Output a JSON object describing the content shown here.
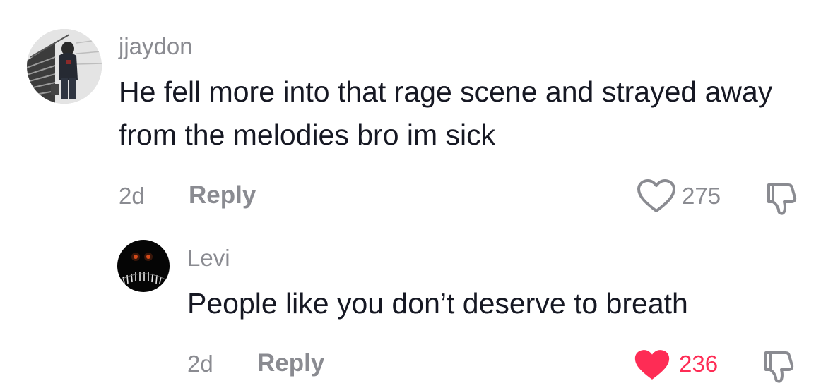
{
  "comments": [
    {
      "username": "jjaydon",
      "text": "He fell more into that rage scene and strayed away from the melodies bro im sick",
      "age": "2d",
      "reply_label": "Reply",
      "likes": "275",
      "liked": false
    },
    {
      "username": "Levi",
      "text": "People like you don’t deserve to breath",
      "age": "2d",
      "reply_label": "Reply",
      "likes": "236",
      "liked": true
    }
  ],
  "colors": {
    "muted_text": "#8a8b91",
    "body_text": "#161823",
    "liked": "#fe2c55"
  },
  "icons": {
    "like": "heart-icon",
    "dislike": "thumbs-down-icon"
  }
}
